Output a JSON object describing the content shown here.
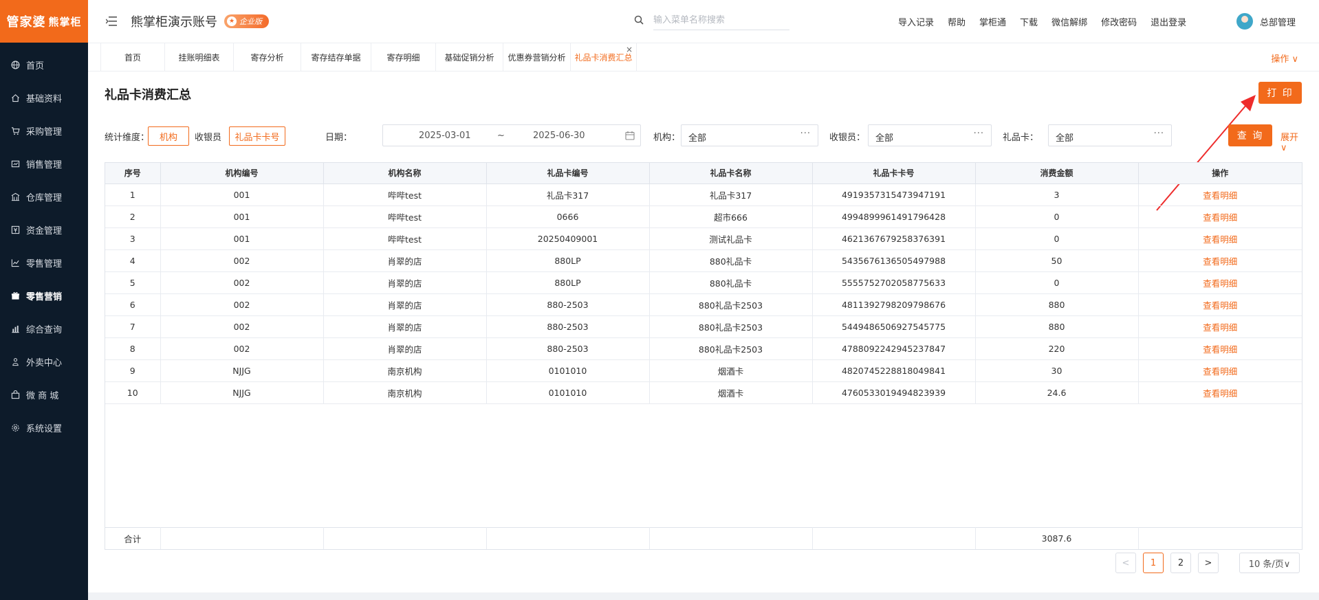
{
  "brand": {
    "logo_main": "管家婆",
    "logo_sub": "熊掌柜",
    "accent_color": "#f26a1b",
    "sidebar_color": "#0d1b2a"
  },
  "header": {
    "account_title": "熊掌柜演示账号",
    "edition_badge": "企业版",
    "search_placeholder": "输入菜单名称搜索",
    "links": [
      "导入记录",
      "帮助",
      "掌柜通",
      "下载",
      "微信解绑",
      "修改密码",
      "退出登录"
    ],
    "user_name": "总部管理"
  },
  "sidebar": {
    "items": [
      {
        "label": "首页",
        "icon": "globe-icon"
      },
      {
        "label": "基础资料",
        "icon": "home-icon"
      },
      {
        "label": "采购管理",
        "icon": "cart-icon"
      },
      {
        "label": "销售管理",
        "icon": "sales-icon"
      },
      {
        "label": "仓库管理",
        "icon": "warehouse-icon"
      },
      {
        "label": "资金管理",
        "icon": "money-icon"
      },
      {
        "label": "零售管理",
        "icon": "chart-icon"
      },
      {
        "label": "零售营销",
        "icon": "gift-icon",
        "active": true
      },
      {
        "label": "综合查询",
        "icon": "bar-chart-icon"
      },
      {
        "label": "外卖中心",
        "icon": "delivery-icon"
      },
      {
        "label": "微 商 城",
        "icon": "shop-icon"
      },
      {
        "label": "系统设置",
        "icon": "gear-icon"
      }
    ]
  },
  "tabs": {
    "items": [
      "首页",
      "挂账明细表",
      "寄存分析",
      "寄存结存单据",
      "寄存明细",
      "基础促销分析",
      "优惠券营销分析",
      "礼品卡消费汇总"
    ],
    "active_index": 7,
    "ops_label": "操作 ∨"
  },
  "page": {
    "title": "礼品卡消费汇总",
    "print_label": "打 印",
    "filters": {
      "dimension_label": "统计维度：",
      "dimensions": [
        "机构",
        "收银员",
        "礼品卡卡号"
      ],
      "date_label": "日期：",
      "date_start": "2025-03-01",
      "date_sep": "~",
      "date_end": "2025-06-30",
      "org_label": "机构：",
      "org_value": "全部",
      "cashier_label": "收银员：",
      "cashier_value": "全部",
      "card_label": "礼品卡：",
      "card_value": "全部",
      "query_label": "查 询",
      "expand_label": "展开∨"
    }
  },
  "table": {
    "columns": [
      "序号",
      "机构编号",
      "机构名称",
      "礼品卡编号",
      "礼品卡名称",
      "礼品卡卡号",
      "消费金额",
      "操作"
    ],
    "rows": [
      [
        "1",
        "001",
        "哔哔test",
        "礼品卡317",
        "礼品卡317",
        "4919357315473947191",
        "3",
        "查看明细"
      ],
      [
        "2",
        "001",
        "哔哔test",
        "0666",
        "超市666",
        "4994899961491796428",
        "0",
        "查看明细"
      ],
      [
        "3",
        "001",
        "哔哔test",
        "20250409001",
        "测试礼品卡",
        "4621367679258376391",
        "0",
        "查看明细"
      ],
      [
        "4",
        "002",
        "肖翠的店",
        "880LP",
        "880礼品卡",
        "5435676136505497988",
        "50",
        "查看明细"
      ],
      [
        "5",
        "002",
        "肖翠的店",
        "880LP",
        "880礼品卡",
        "5555752702058775633",
        "0",
        "查看明细"
      ],
      [
        "6",
        "002",
        "肖翠的店",
        "880-2503",
        "880礼品卡2503",
        "4811392798209798676",
        "880",
        "查看明细"
      ],
      [
        "7",
        "002",
        "肖翠的店",
        "880-2503",
        "880礼品卡2503",
        "5449486506927545775",
        "880",
        "查看明细"
      ],
      [
        "8",
        "002",
        "肖翠的店",
        "880-2503",
        "880礼品卡2503",
        "4788092242945237847",
        "220",
        "查看明细"
      ],
      [
        "9",
        "NJJG",
        "南京机构",
        "0101010",
        "烟酒卡",
        "4820745228818049841",
        "30",
        "查看明细"
      ],
      [
        "10",
        "NJJG",
        "南京机构",
        "0101010",
        "烟酒卡",
        "4760533019494823939",
        "24.6",
        "查看明细"
      ]
    ],
    "total_label": "合计",
    "total_amount": "3087.6"
  },
  "pagination": {
    "prev": "<",
    "pages": [
      "1",
      "2"
    ],
    "current": "1",
    "next": ">",
    "page_size": "10 条/页∨"
  }
}
